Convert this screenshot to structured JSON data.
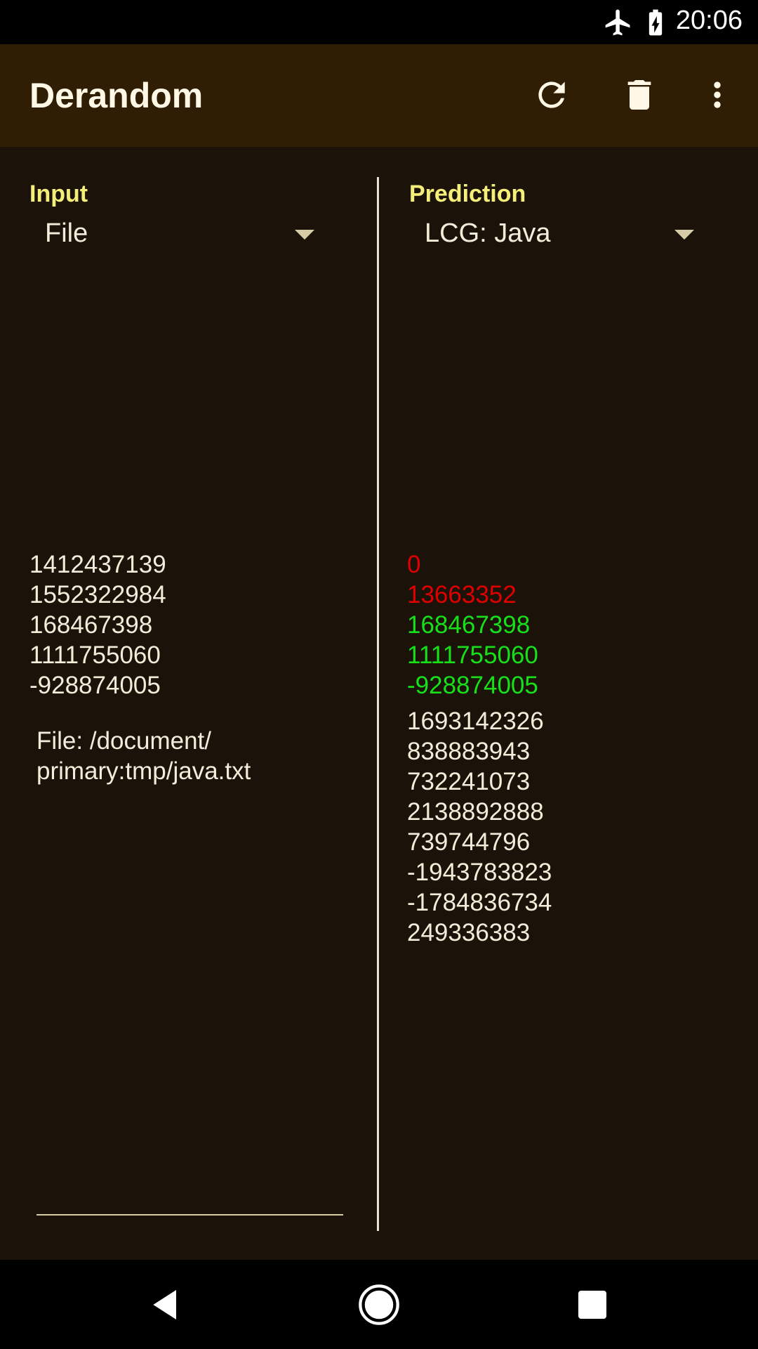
{
  "status_bar": {
    "time": "20:06",
    "icons": [
      "airplane-mode-icon",
      "battery-charging-icon"
    ]
  },
  "app_bar": {
    "title": "Derandom",
    "actions": [
      "refresh-icon",
      "delete-icon",
      "more-vert-icon"
    ]
  },
  "input": {
    "label": "Input",
    "source_selected": "File",
    "numbers": [
      "1412437139",
      "1552322984",
      "168467398",
      "1111755060",
      "-928874005"
    ],
    "file_info": "File: /document/ primary:tmp/java.txt"
  },
  "prediction": {
    "label": "Prediction",
    "algorithm_selected": "LCG: Java",
    "matched_numbers": [
      {
        "value": "0",
        "status": "miss",
        "color": "#e00000"
      },
      {
        "value": "13663352",
        "status": "miss",
        "color": "#e00000"
      },
      {
        "value": "168467398",
        "status": "hit",
        "color": "#18e018"
      },
      {
        "value": "1111755060",
        "status": "hit",
        "color": "#18e018"
      },
      {
        "value": "-928874005",
        "status": "hit",
        "color": "#18e018"
      }
    ],
    "next_numbers": [
      "1693142326",
      "838883943",
      "732241073",
      "2138892888",
      "739744796",
      "-1943783823",
      "-1784836734",
      "249336383"
    ]
  },
  "colors": {
    "app_bar": "#301e04",
    "background": "#1b130a",
    "label_accent": "#f5ef7a",
    "text": "#f3ecd8",
    "miss": "#e00000",
    "hit": "#18e018"
  },
  "nav_bar": {
    "buttons": [
      "back-icon",
      "home-icon",
      "recents-icon"
    ]
  }
}
